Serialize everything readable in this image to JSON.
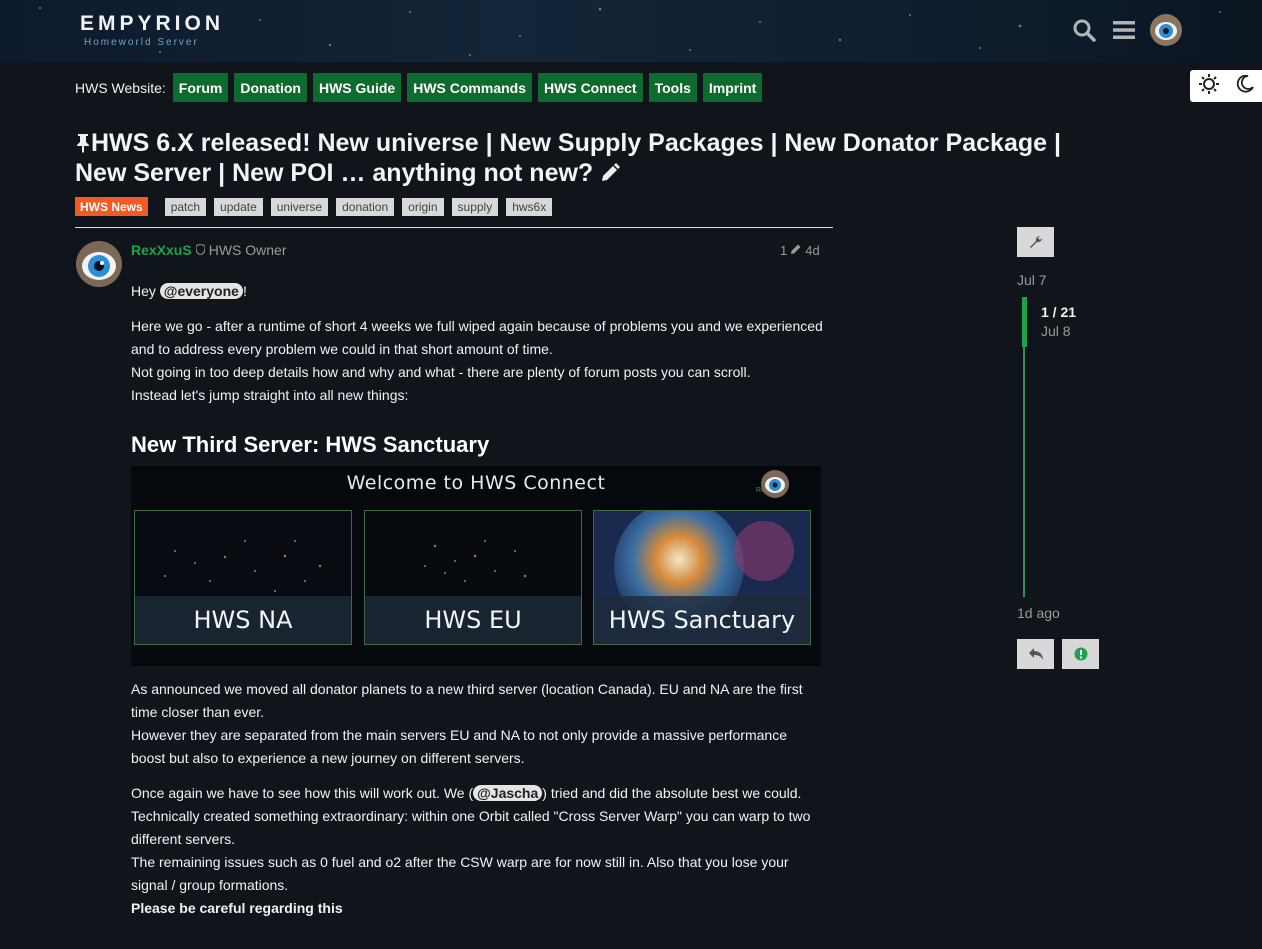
{
  "header": {
    "logo_title": "EMPYRION",
    "logo_subtitle": "Homeworld Server"
  },
  "nav": {
    "label": "HWS Website:",
    "links": [
      "Forum",
      "Donation",
      "HWS Guide",
      "HWS Commands",
      "HWS Connect",
      "Tools",
      "Imprint"
    ]
  },
  "topic": {
    "title": "HWS 6.X released! New universe | New Supply Packages | New Donator Package | New Server | New POI … anything not new?",
    "category": "HWS News",
    "category_color": "#f15a24",
    "tags": [
      "patch",
      "update",
      "universe",
      "donation",
      "origin",
      "supply",
      "hws6x"
    ]
  },
  "post": {
    "username": "RexXxuS",
    "user_title": "HWS Owner",
    "edit_count": "1",
    "age": "4d",
    "greeting_prefix": "Hey ",
    "greeting_mention": "@everyone",
    "greeting_suffix": "!",
    "intro_lines": [
      "Here we go - after a runtime of short 4 weeks we full wiped again because of problems you and we experienced and to address every problem we could in that short amount of time.",
      "Not going in too deep details how and why and what - there are plenty of forum posts you can scroll.",
      "Instead let's jump straight into all new things:"
    ],
    "heading": "New Third Server: HWS Sanctuary",
    "banner": {
      "title": "Welcome to HWS Connect",
      "author": "RexXxuS",
      "servers": [
        "HWS NA",
        "HWS EU",
        "HWS Sanctuary"
      ]
    },
    "para2_lines": [
      "As announced we moved all donator planets to a new third server (location Canada). EU and NA are the first time closer than ever.",
      "However they are separated from the main servers EU and NA to not only provide a massive performance boost but also to experience a new journey on different servers."
    ],
    "para3_prefix": "Once again we have to see how this will work out. We (",
    "para3_mention": "@Jascha",
    "para3_suffix": ") tried and did the absolute best we could.",
    "para3_lines": [
      "Technically created something extraordinary: within one Orbit called \"Cross Server Warp\" you can warp to two different servers.",
      "The remaining issues such as 0 fuel and o2 after the CSW warp are for now still in. Also that you lose your signal / group formations."
    ],
    "bold_line": "Please be careful regarding this"
  },
  "timeline": {
    "start_date": "Jul 7",
    "position": "1 / 21",
    "current_date": "Jul 8",
    "end_label": "1d ago"
  }
}
